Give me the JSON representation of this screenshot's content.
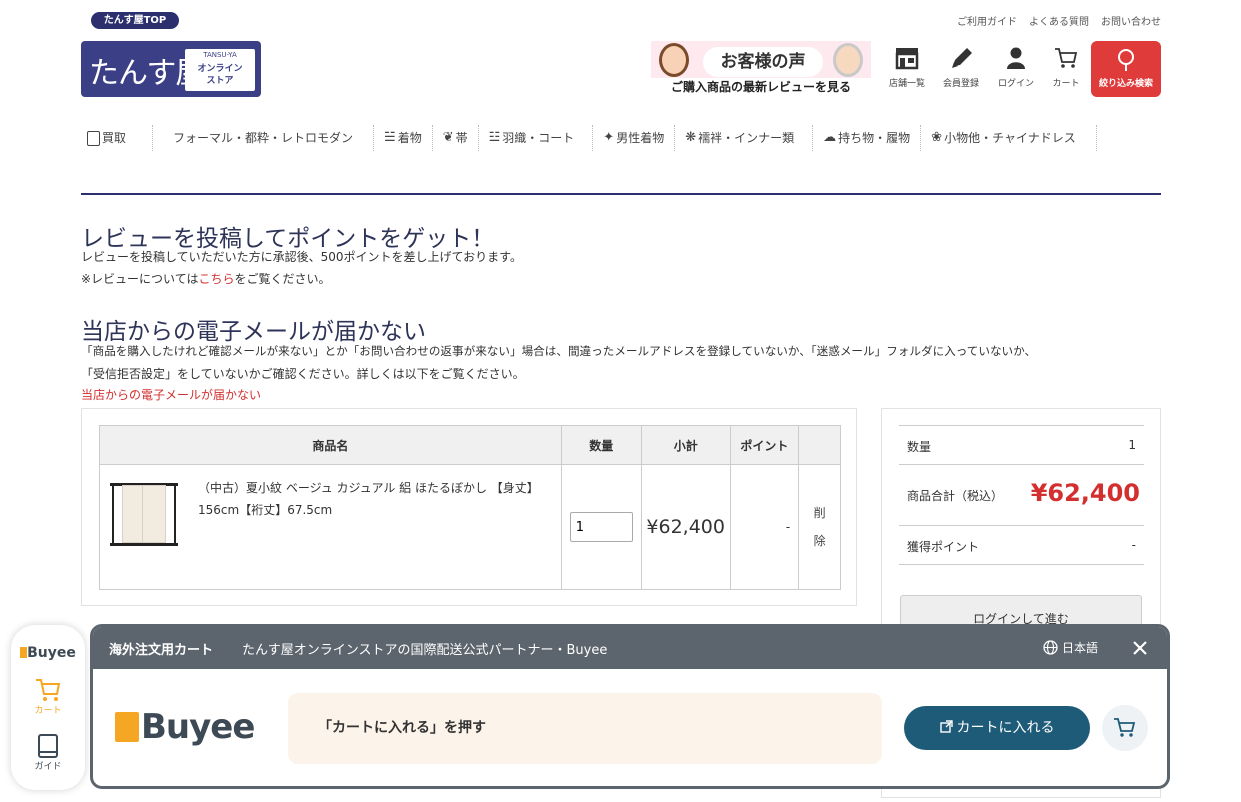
{
  "header": {
    "top_badge": "たんす屋TOP",
    "logo_main": "たんす屋",
    "logo_en": "TANSU-YA",
    "logo_jp": "オンライン\nストア",
    "links": [
      "ご利用ガイド",
      "よくある質問",
      "お問い合わせ"
    ],
    "banner_title": "お客様の声",
    "banner_sub": "ご購入商品の最新レビューを見る",
    "icons": [
      {
        "label": "店舗一覧",
        "icon": "store-icon"
      },
      {
        "label": "会員登録",
        "icon": "pencil-icon"
      },
      {
        "label": "ログイン",
        "icon": "user-icon"
      },
      {
        "label": "カート",
        "icon": "cart-icon"
      }
    ],
    "search_label": "絞り込み検索"
  },
  "nav": [
    {
      "label": "買取",
      "icon": "buyback-icon"
    },
    {
      "label": "フォーマル・都粋・レトロモダン",
      "icon": ""
    },
    {
      "label": "着物",
      "icon": "kimono-icon"
    },
    {
      "label": "帯",
      "icon": "obi-icon"
    },
    {
      "label": "羽織・コート",
      "icon": "haori-icon"
    },
    {
      "label": "男性着物",
      "icon": "mens-icon"
    },
    {
      "label": "襦袢・インナー類",
      "icon": "juban-icon"
    },
    {
      "label": "持ち物・履物",
      "icon": "accessory-icon"
    },
    {
      "label": "小物他・チャイナドレス",
      "icon": "flower-icon"
    }
  ],
  "review": {
    "title": "レビューを投稿してポイントをゲット！",
    "line1": "レビューを投稿していただいた方に承認後、500ポイントを差し上げております。",
    "line2_pre": "※レビューについては",
    "line2_link": "こちら",
    "line2_post": "をご覧ください。"
  },
  "email": {
    "title": "当店からの電子メールが届かない",
    "line1": "「商品を購入したけれど確認メールが来ない」とか「お問い合わせの返事が来ない」場合は、間違ったメールアドレスを登録していないか、「迷惑メール」フォルダに入っていないか、",
    "line2": "「受信拒否設定」をしていないかご確認ください。詳しくは以下をご覧ください。",
    "link": "当店からの電子メールが届かない"
  },
  "cart": {
    "headers": [
      "商品名",
      "数量",
      "小計",
      "ポイント",
      ""
    ],
    "item": {
      "name": "（中古）夏小紋 ベージュ カジュアル 絽 ほたるぼかし 【身丈】156cm【裄丈】67.5cm",
      "qty": "1",
      "subtotal": "¥62,400",
      "points": "-",
      "delete": "削\n除"
    }
  },
  "summary": {
    "qty_label": "数量",
    "qty_value": "1",
    "total_label": "商品合計（税込）",
    "total_value": "¥62,400",
    "points_label": "獲得ポイント",
    "points_value": "-",
    "login_button": "ログインして進む"
  },
  "buyee": {
    "side_logo": "Buyee",
    "side_cart": "カート",
    "side_guide": "ガイド",
    "head_title": "海外注文用カート",
    "head_desc": "たんす屋オンラインストアの国際配送公式パートナー・Buyee",
    "lang": "日本語",
    "logo": "Buyee",
    "message": "「カートに入れる」を押す",
    "cart_button": "カートに入れる"
  },
  "colors": {
    "navy": "#2b2f6e",
    "accent_red": "#e03b3b",
    "price_red": "#d32f2f",
    "buyee_orange": "#f5a623",
    "buyee_teal": "#1e5b78",
    "buyee_gray": "#5c656d"
  }
}
